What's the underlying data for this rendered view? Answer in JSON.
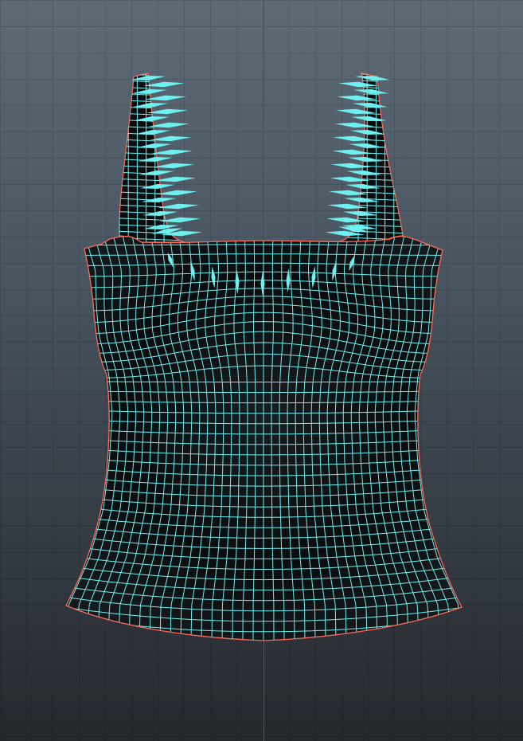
{
  "viewport": {
    "mode": "uv-unfold",
    "object": "tank-top-mesh"
  },
  "colors": {
    "wire": "#6ff0f0",
    "border": "#ff6a5a",
    "mesh_fill": "#0b0d0f",
    "axis": "#2f5f8f",
    "spike": "#6ff0f0"
  },
  "mesh": {
    "rows": 42,
    "cols": 40
  }
}
